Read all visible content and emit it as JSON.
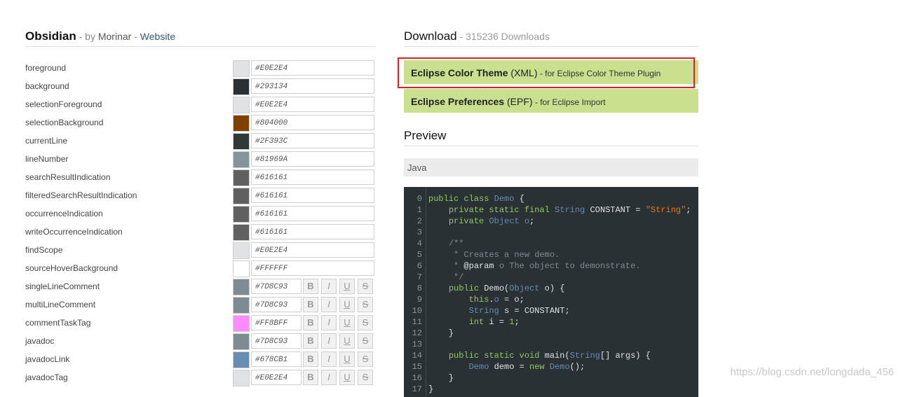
{
  "theme": {
    "name": "Obsidian",
    "by_prefix": " - by ",
    "author": "Morinar",
    "sep": " - ",
    "website": "Website"
  },
  "properties": [
    {
      "label": "foreground",
      "hex": "#E0E2E4",
      "color": "#E0E2E4",
      "styles": false
    },
    {
      "label": "background",
      "hex": "#293134",
      "color": "#293134",
      "styles": false
    },
    {
      "label": "selectionForeground",
      "hex": "#E0E2E4",
      "color": "#E0E2E4",
      "styles": false
    },
    {
      "label": "selectionBackground",
      "hex": "#804000",
      "color": "#804000",
      "styles": false
    },
    {
      "label": "currentLine",
      "hex": "#2F393C",
      "color": "#2F393C",
      "styles": false
    },
    {
      "label": "lineNumber",
      "hex": "#81969A",
      "color": "#81969A",
      "styles": false
    },
    {
      "label": "searchResultIndication",
      "hex": "#616161",
      "color": "#616161",
      "styles": false
    },
    {
      "label": "filteredSearchResultIndication",
      "hex": "#616161",
      "color": "#616161",
      "styles": false
    },
    {
      "label": "occurrenceIndication",
      "hex": "#616161",
      "color": "#616161",
      "styles": false
    },
    {
      "label": "writeOccurrenceIndication",
      "hex": "#616161",
      "color": "#616161",
      "styles": false
    },
    {
      "label": "findScope",
      "hex": "#E0E2E4",
      "color": "#E0E2E4",
      "styles": false
    },
    {
      "label": "sourceHoverBackground",
      "hex": "#FFFFFF",
      "color": "#FFFFFF",
      "styles": false
    },
    {
      "label": "singleLineComment",
      "hex": "#7D8C93",
      "color": "#7D8C93",
      "styles": true
    },
    {
      "label": "multiLineComment",
      "hex": "#7D8C93",
      "color": "#7D8C93",
      "styles": true
    },
    {
      "label": "commentTaskTag",
      "hex": "#FF8BFF",
      "color": "#FF8BFF",
      "styles": true
    },
    {
      "label": "javadoc",
      "hex": "#7D8C93",
      "color": "#7D8C93",
      "styles": true
    },
    {
      "label": "javadocLink",
      "hex": "#678CB1",
      "color": "#678CB1",
      "styles": true
    },
    {
      "label": "javadocTag",
      "hex": "#E0E2E4",
      "color": "#E0E2E4",
      "styles": true
    }
  ],
  "style_buttons": {
    "bold": "B",
    "italic": "I",
    "underline": "U",
    "strike": "S"
  },
  "download": {
    "title": "Download",
    "count": " - 315236 Downloads",
    "buttons": [
      {
        "name": "Eclipse Color Theme",
        "format": " (XML)",
        "note": " - for Eclipse Color Theme Plugin"
      },
      {
        "name": "Eclipse Preferences",
        "format": " (EPF)",
        "note": " - for Eclipse Import"
      }
    ]
  },
  "preview": {
    "title": "Preview",
    "language": "Java"
  },
  "code_lines": [
    {
      "n": "0",
      "parts": [
        [
          "kw",
          "public class "
        ],
        [
          "ty",
          "Demo"
        ],
        [
          "tx",
          " {"
        ]
      ]
    },
    {
      "n": "1",
      "parts": [
        [
          "tx",
          "    "
        ],
        [
          "kw",
          "private static final "
        ],
        [
          "ty",
          "String"
        ],
        [
          "tx",
          " CONSTANT = "
        ],
        [
          "str",
          "\"String\""
        ],
        [
          "tx",
          ";"
        ]
      ]
    },
    {
      "n": "2",
      "parts": [
        [
          "tx",
          "    "
        ],
        [
          "kw",
          "private "
        ],
        [
          "ty",
          "Object"
        ],
        [
          "tx",
          " "
        ],
        [
          "ty",
          "o"
        ],
        [
          "tx",
          ";"
        ]
      ]
    },
    {
      "n": "3",
      "parts": []
    },
    {
      "n": "4",
      "parts": [
        [
          "tx",
          "    "
        ],
        [
          "cm",
          "/**"
        ]
      ]
    },
    {
      "n": "5",
      "parts": [
        [
          "tx",
          "    "
        ],
        [
          "cm",
          " * Creates a new demo."
        ]
      ]
    },
    {
      "n": "6",
      "parts": [
        [
          "tx",
          "    "
        ],
        [
          "cm",
          " * "
        ],
        [
          "tag",
          "@param"
        ],
        [
          "cm",
          " o The object to demonstrate."
        ]
      ]
    },
    {
      "n": "7",
      "parts": [
        [
          "tx",
          "    "
        ],
        [
          "cm",
          " */"
        ]
      ]
    },
    {
      "n": "8",
      "parts": [
        [
          "tx",
          "    "
        ],
        [
          "kw",
          "public "
        ],
        [
          "tx",
          "Demo("
        ],
        [
          "ty",
          "Object"
        ],
        [
          "tx",
          " o) {"
        ]
      ]
    },
    {
      "n": "9",
      "parts": [
        [
          "tx",
          "        "
        ],
        [
          "kw",
          "this"
        ],
        [
          "tx",
          "."
        ],
        [
          "ty",
          "o"
        ],
        [
          "tx",
          " = o;"
        ]
      ]
    },
    {
      "n": "10",
      "parts": [
        [
          "tx",
          "        "
        ],
        [
          "ty",
          "String"
        ],
        [
          "tx",
          " s = CONSTANT;"
        ]
      ]
    },
    {
      "n": "11",
      "parts": [
        [
          "tx",
          "        "
        ],
        [
          "kw",
          "int"
        ],
        [
          "tx",
          " i = "
        ],
        [
          "kw",
          "1"
        ],
        [
          "tx",
          ";"
        ]
      ]
    },
    {
      "n": "12",
      "parts": [
        [
          "tx",
          "    }"
        ]
      ]
    },
    {
      "n": "13",
      "parts": []
    },
    {
      "n": "14",
      "parts": [
        [
          "tx",
          "    "
        ],
        [
          "kw",
          "public static void "
        ],
        [
          "tx",
          "main("
        ],
        [
          "ty",
          "String"
        ],
        [
          "tx",
          "[] args) {"
        ]
      ]
    },
    {
      "n": "15",
      "parts": [
        [
          "tx",
          "        "
        ],
        [
          "ty",
          "Demo"
        ],
        [
          "tx",
          " demo = "
        ],
        [
          "kw",
          "new "
        ],
        [
          "ty",
          "Demo"
        ],
        [
          "tx",
          "();"
        ]
      ]
    },
    {
      "n": "16",
      "parts": [
        [
          "tx",
          "    }"
        ]
      ]
    },
    {
      "n": "17",
      "parts": [
        [
          "tx",
          "}"
        ]
      ]
    }
  ],
  "watermark": "https://blog.csdn.net/longdada_456"
}
